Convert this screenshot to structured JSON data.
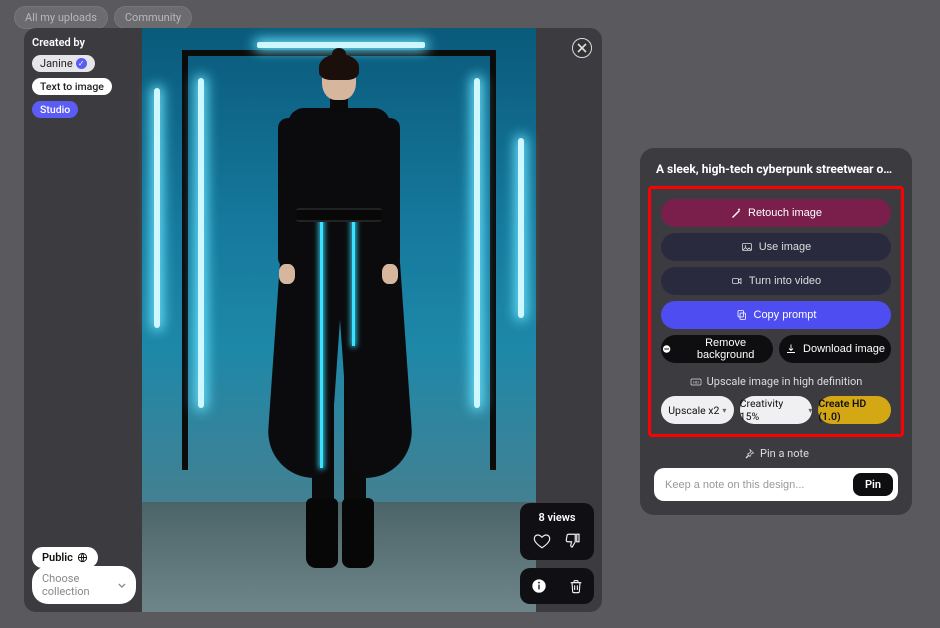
{
  "bg_tabs": {
    "all": "All my uploads",
    "community": "Community"
  },
  "card": {
    "created_by_label": "Created by",
    "author": "Janine",
    "tag_text_to_image": "Text to image",
    "tag_studio": "Studio",
    "views_count": "8",
    "views_word": "views",
    "public_label": "Public",
    "collection_placeholder": "Choose collection"
  },
  "panel": {
    "prompt": "A sleek, high-tech cyberpunk streetwear outfit...",
    "retouch": "Retouch image",
    "use": "Use image",
    "video": "Turn into video",
    "copy": "Copy prompt",
    "remove_bg": "Remove background",
    "download": "Download image",
    "upscale_title": "Upscale image in high definition",
    "upscale_sel": "Upscale x2",
    "creativity_sel": "Creativity 15%",
    "create_hd": "Create HD (1.0)",
    "pin_note_label": "Pin a note",
    "note_placeholder": "Keep a note on this design...",
    "pin_button": "Pin"
  }
}
